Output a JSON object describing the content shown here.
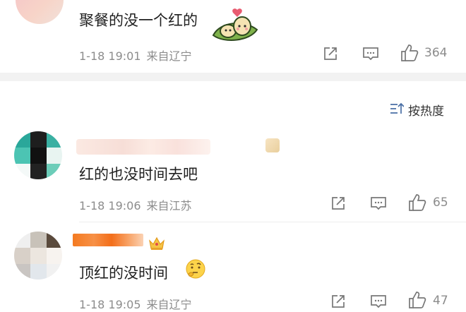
{
  "top_comment": {
    "text": "聚餐的没一个红的",
    "sticker_icon": "cartoon-sticker",
    "time": "1-18 19:01",
    "location": "来自辽宁",
    "likes": "364"
  },
  "sort": {
    "label": "按热度",
    "icon": "sort-icon"
  },
  "comments": [
    {
      "text": "红的也没时间去吧",
      "time": "1-18 19:06",
      "location": "来自江苏",
      "likes": "65",
      "badge": "level-badge"
    },
    {
      "text": "顶红的没时间",
      "emoji": "thinking-face",
      "time": "1-18 19:05",
      "location": "来自辽宁",
      "likes": "47",
      "badge": "crown-badge"
    }
  ],
  "colors": {
    "text": "#1f1f1f",
    "meta": "#8c8c8c",
    "divider": "#f2f2f2",
    "username_orange": "#f77b1d"
  }
}
